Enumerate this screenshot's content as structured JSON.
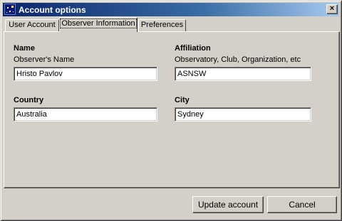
{
  "window": {
    "title": "Account options",
    "close_glyph": "×",
    "icon": "starfield-app-icon"
  },
  "tabs": [
    {
      "label": "User Account",
      "active": false
    },
    {
      "label": "Observer Information",
      "active": true
    },
    {
      "label": "Preferences",
      "active": false
    }
  ],
  "form": {
    "name": {
      "label": "Name",
      "hint": "Observer's Name",
      "value": "Hristo Pavlov"
    },
    "affiliation": {
      "label": "Affiliation",
      "hint": "Observatory, Club, Organization, etc",
      "value": "ASNSW"
    },
    "country": {
      "label": "Country",
      "value": "Australia"
    },
    "city": {
      "label": "City",
      "value": "Sydney"
    }
  },
  "buttons": {
    "update": "Update account",
    "cancel": "Cancel"
  }
}
